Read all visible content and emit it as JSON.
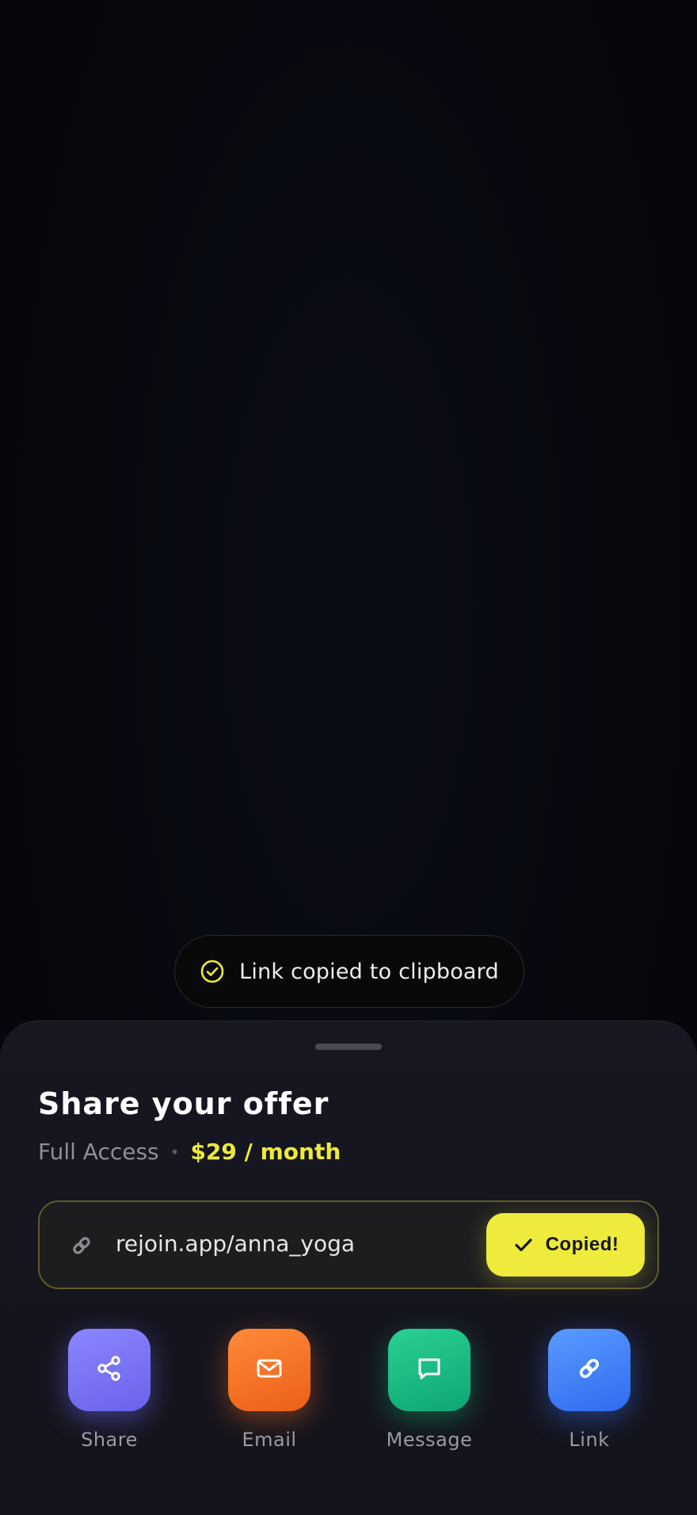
{
  "toast": {
    "message": "Link copied to clipboard",
    "icon": "check-circle-icon",
    "accent": "#eeea3a"
  },
  "sheet": {
    "title": "Share your offer",
    "plan_name": "Full Access",
    "separator": "•",
    "price": "$29 / month",
    "link": {
      "url": "rejoin.app/anna_yoga",
      "icon": "link-icon",
      "button_label": "Copied!",
      "button_icon": "check-icon"
    },
    "actions": [
      {
        "label": "Share",
        "icon": "share-icon",
        "color": "#7a73f5"
      },
      {
        "label": "Email",
        "icon": "mail-icon",
        "color": "#f2701f"
      },
      {
        "label": "Message",
        "icon": "message-icon",
        "color": "#18b882"
      },
      {
        "label": "Link",
        "icon": "link-icon",
        "color": "#3f7ff7"
      }
    ]
  },
  "colors": {
    "background": "#07080e",
    "sheet": "#16161f",
    "accent_yellow": "#eeeb3c"
  }
}
